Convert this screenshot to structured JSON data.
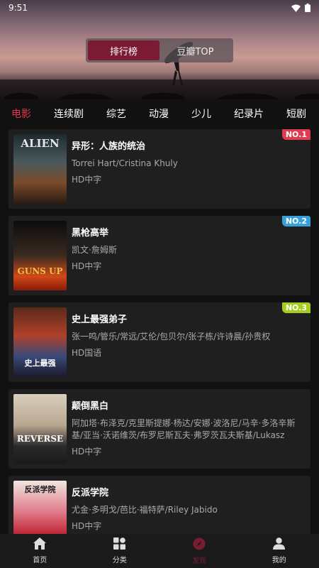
{
  "status": {
    "time": "9:51"
  },
  "hero": {
    "segments": [
      {
        "label": "排行榜",
        "active": true
      },
      {
        "label": "豆瓣TOP",
        "active": false
      }
    ]
  },
  "tabs": [
    {
      "label": "电影",
      "active": true
    },
    {
      "label": "连续剧",
      "active": false
    },
    {
      "label": "综艺",
      "active": false
    },
    {
      "label": "动漫",
      "active": false
    },
    {
      "label": "少儿",
      "active": false
    },
    {
      "label": "纪录片",
      "active": false
    },
    {
      "label": "短剧",
      "active": false
    }
  ],
  "movies": [
    {
      "title": "异形：人族的统治",
      "cast": "Torrei Hart/Cristina Khuly",
      "quality": "HD中字",
      "rank": "NO.1",
      "rank_color": "#e03b4e",
      "poster_text": "ALIEN"
    },
    {
      "title": "黑枪高举",
      "cast": "凯文·詹姆斯",
      "quality": "HD中字",
      "rank": "NO.2",
      "rank_color": "#3aa0dc",
      "poster_text": "GUNS UP"
    },
    {
      "title": "史上最强弟子",
      "cast": "张一鸣/管乐/常远/艾伦/包贝尔/张子栋/许诗晨/孙贵权",
      "quality": "HD国语",
      "rank": "NO.3",
      "rank_color": "#a6cc1d",
      "poster_text": "史上最强"
    },
    {
      "title": "颠倒黑白",
      "cast": "阿加塔·布泽克/克里斯提娜·杨达/安娜·波洛尼/马辛·多洛辛斯基/亚当·沃诺维茨/布罗尼斯瓦夫·弗罗茨瓦夫斯基/Lukasz Konopka",
      "quality": "HD中字",
      "rank": "",
      "rank_color": "",
      "poster_text": "REVERSE"
    },
    {
      "title": "反派学院",
      "cast": "尤金·多明戈/芭比·福特萨/Riley Jabido",
      "quality": "HD中字",
      "rank": "",
      "rank_color": "",
      "poster_text": "反派学院"
    }
  ],
  "bottom_nav": [
    {
      "label": "首页",
      "icon": "home-icon",
      "active": false
    },
    {
      "label": "分类",
      "icon": "category-icon",
      "active": false
    },
    {
      "label": "发现",
      "icon": "compass-icon",
      "active": true
    },
    {
      "label": "我的",
      "icon": "user-icon",
      "active": false
    }
  ]
}
